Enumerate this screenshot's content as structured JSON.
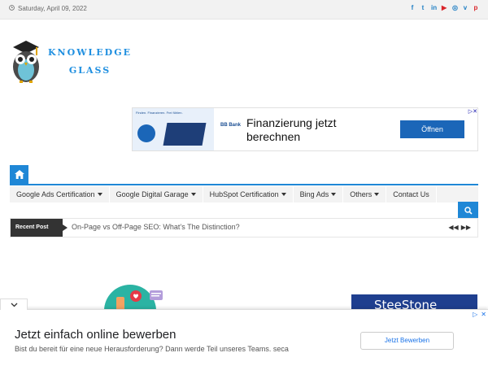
{
  "topbar": {
    "date": "Saturday, April 09, 2022",
    "social": [
      {
        "icon": "facebook-icon",
        "glyph": "f"
      },
      {
        "icon": "twitter-icon",
        "glyph": "t"
      },
      {
        "icon": "linkedin-icon",
        "glyph": "in"
      },
      {
        "icon": "youtube-icon",
        "glyph": "▶"
      },
      {
        "icon": "instagram-icon",
        "glyph": "◎"
      },
      {
        "icon": "vimeo-icon",
        "glyph": "v"
      },
      {
        "icon": "pinterest-icon",
        "glyph": "p"
      }
    ]
  },
  "logo": {
    "line1": "KNOWLEDGE",
    "line2": "GLASS"
  },
  "top_ad": {
    "small_text": "Finden. Finanzieren. Frei fühlen.",
    "bank": "BB Bank",
    "headline_line1": "Finanzierung jetzt",
    "headline_line2": "berechnen",
    "cta": "Öffnen"
  },
  "nav": {
    "items": [
      {
        "label": "Google Ads Certification",
        "dropdown": true
      },
      {
        "label": "Google Digital Garage",
        "dropdown": true
      },
      {
        "label": "HubSpot Certification",
        "dropdown": true
      },
      {
        "label": "Bing Ads",
        "dropdown": true
      },
      {
        "label": "Others",
        "dropdown": true
      },
      {
        "label": "Contact Us",
        "dropdown": false
      }
    ]
  },
  "ticker": {
    "label": "Recent Post",
    "title": "On-Page vs Off-Page SEO: What’s The Distinction?"
  },
  "side_ad": {
    "wordmark": "SteeStone"
  },
  "bottom_ad": {
    "headline": "Jetzt einfach online bewerben",
    "subtext": "Bist du bereit für eine neue Herausforderung? Dann werde Teil unseres Teams. seca",
    "cta": "Jetzt Bewerben"
  },
  "colors": {
    "accent": "#1f87d6",
    "topbar_bg": "#f2f2f2",
    "label_bg": "#333333"
  }
}
